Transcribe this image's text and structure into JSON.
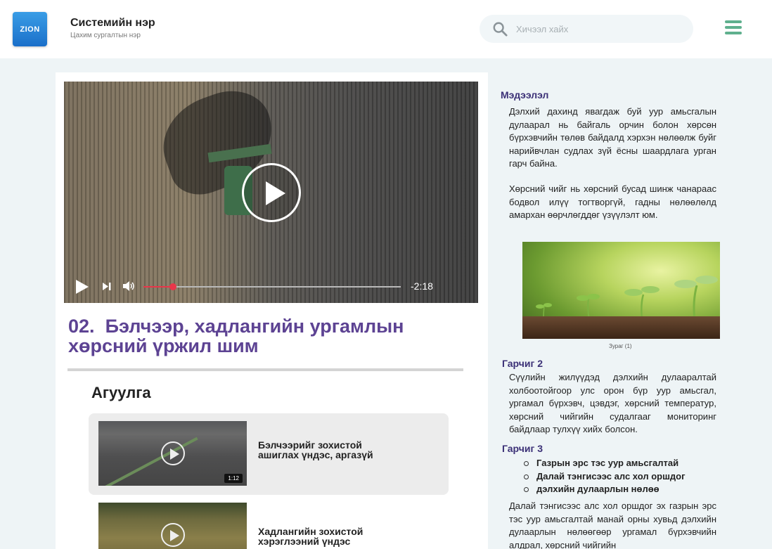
{
  "header": {
    "logo_text": "ZION",
    "system_name": "Системийн нэр",
    "system_subtitle": "Цахим сургалтын нэр",
    "search_placeholder": "Хичээл хайх",
    "search_icon": "search-icon",
    "menu_icon": "hamburger-menu-icon",
    "menu_color": "#5fb08e"
  },
  "player": {
    "time_remaining": "-2:18",
    "progress_fraction": 0.115,
    "progress_color": "#e8364a"
  },
  "lesson": {
    "number": "02.",
    "title": "Бэлчээр, хадлангийн ургамлын хөрсний үржил шим",
    "contents_heading": "Агуулга",
    "items": [
      {
        "label": "Бэлчээрийг зохистой ашиглах үндэс, аргазүй",
        "duration": "1:12"
      },
      {
        "label": "Хадлангийн зохистой хэрэглээний үндэс",
        "duration": ""
      }
    ]
  },
  "info": {
    "heading1": "Мэдээлэл",
    "para1": "Дэлхий дахинд явагдаж буй уур амьсгалын дулаарал нь байгаль орчин болон хөрсөн бүрхэвчийн төлөв байдалд хэрхэн нөлөөлж буйг нарийвчлан судлах зүй ёсны шаардлага урган гарч байна.",
    "para2": "Хөрсний чийг нь хөрсний бусад шинж чанараас бодвол илүү тогтворгүй, гадны нөлөөлөлд амархан өөрчлөгддөг үзүүлэлт юм.",
    "image_caption": "Зураг (1)",
    "heading2": "Гарчиг 2",
    "para3": "Сүүлийн жилүүдэд дэлхийн дулааралтай холбоотойгоор улс орон бүр уур амьсгал, ургамал бүрхэвч, цэвдэг, хөрсний температур, хөрсний чийгийн судалгааг мониторинг байдлаар тулхүү хийх болсон.",
    "heading3": "Гарчиг 3",
    "bullets": [
      "Газрын эрс тэс уур амьсгалтай",
      "Далай тэнгисээс алс хол оршдог",
      "дэлхийн дулаарлын нөлөө"
    ],
    "para4": "Далай тэнгисээс алс хол оршдог эх газрын эрс тэс уур амьсгалтай манай орны хувьд дэлхийн дулаарлын нөлөөгөөр ургамал бүрхэвчийн алдрал, хөрсний чийгийн"
  }
}
